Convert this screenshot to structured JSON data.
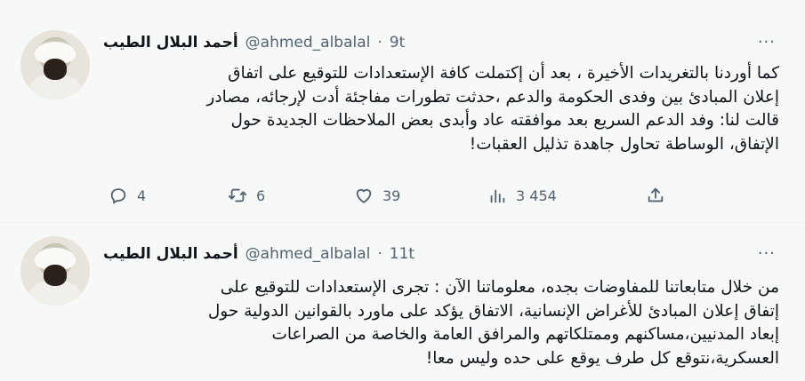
{
  "tweets": [
    {
      "author_name": "أحمد البلال الطيب",
      "handle": "@ahmed_albalal",
      "separator": "·",
      "time": "9t",
      "more": "···",
      "lines": [
        "كما أوردنا بالتغريدات الأخيرة ، بعد أن إكتملت كافة الإستعدادات للتوقيع على اتفاق",
        "إعلان المبادئ بين وفدى الحكومة والدعم ،حدثت تطورات مفاجئة أدت لإرجائه، مصادر",
        "قالت لنا: وفد الدعم السريع بعد موافقته عاد وأبدى بعض الملاحظات  الجديدة  حول",
        "الإتفاق، الوساطة تحاول جاهدة  تذليل العقبات!"
      ],
      "reply_count": "4",
      "retweet_count": "6",
      "like_count": "39",
      "view_count": "3 454",
      "icons": {
        "reply": "reply-icon",
        "retweet": "retweet-icon",
        "like": "like-icon",
        "views": "views-icon",
        "share": "share-icon"
      }
    },
    {
      "author_name": "أحمد البلال الطيب",
      "handle": "@ahmed_albalal",
      "separator": "·",
      "time": "11t",
      "more": "···",
      "lines": [
        "من خلال متابعاتنا للمفاوضات بجده، معلوماتنا الآن : تجرى الإستعدادات للتوقيع على",
        "إتفاق إعلان المبادئ للأغراض الإنسانية، الاتفاق يؤكد على ماورد بالقوانين الدولية حول",
        "إبعاد المدنيين،مساكنهم وممتلكاتهم والمرافق العامة والخاصة من الصراعات",
        "العسكرية،نتوقع كل طرف يوقع على حده وليس معا!"
      ]
    }
  ],
  "colors": {
    "background": "#f7f9f9",
    "text": "#0f1419",
    "secondary": "#536471"
  }
}
